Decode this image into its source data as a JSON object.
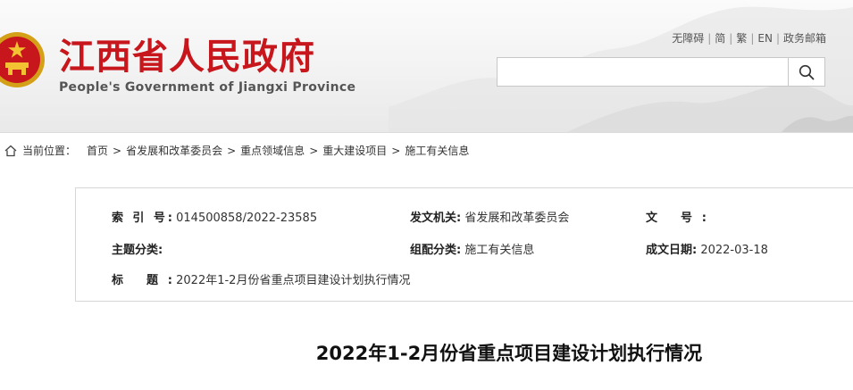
{
  "header": {
    "title": "江西省人民政府",
    "subtitle": "People's Government of Jiangxi Province",
    "top_links": [
      "无障碍",
      "简",
      "繁",
      "EN",
      "政务邮箱"
    ],
    "search": {
      "placeholder": "",
      "icon": "search-icon"
    }
  },
  "breadcrumb": {
    "label": "当前位置：",
    "items": [
      "首页",
      "省发展和改革委员会",
      "重点领域信息",
      "重大建设项目",
      "施工有关信息"
    ]
  },
  "meta": {
    "index_label": "索 引 号:",
    "index_value": "014500858/2022-23585",
    "issuer_label": "发文机关:",
    "issuer_value": "省发展和改革委员会",
    "docno_label": "文    号:",
    "docno_value": "",
    "topic_label": "主题分类:",
    "topic_value": "",
    "group_label": "组配分类:",
    "group_value": "施工有关信息",
    "date_label": "成文日期:",
    "date_value": "2022-03-18",
    "title_label": "标    题:",
    "title_value": "2022年1-2月份省重点项目建设计划执行情况"
  },
  "article": {
    "title": "2022年1-2月份省重点项目建设计划执行情况"
  },
  "colors": {
    "brand_red": "#c8161d",
    "gold": "#f2c233"
  }
}
